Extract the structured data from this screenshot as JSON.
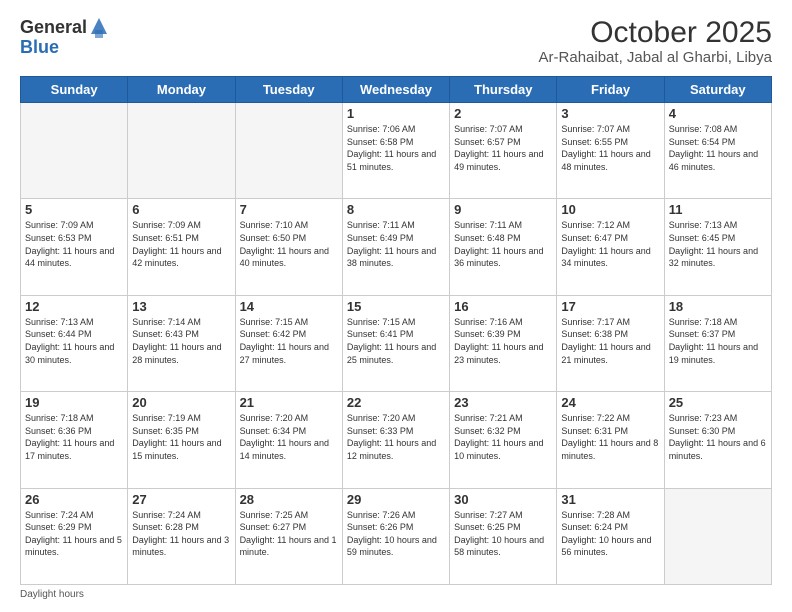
{
  "header": {
    "logo_general": "General",
    "logo_blue": "Blue",
    "title": "October 2025",
    "subtitle": "Ar-Rahaibat, Jabal al Gharbi, Libya"
  },
  "weekdays": [
    "Sunday",
    "Monday",
    "Tuesday",
    "Wednesday",
    "Thursday",
    "Friday",
    "Saturday"
  ],
  "footer": {
    "note": "Daylight hours"
  },
  "weeks": [
    [
      {
        "day": "",
        "info": ""
      },
      {
        "day": "",
        "info": ""
      },
      {
        "day": "",
        "info": ""
      },
      {
        "day": "1",
        "info": "Sunrise: 7:06 AM\nSunset: 6:58 PM\nDaylight: 11 hours\nand 51 minutes."
      },
      {
        "day": "2",
        "info": "Sunrise: 7:07 AM\nSunset: 6:57 PM\nDaylight: 11 hours\nand 49 minutes."
      },
      {
        "day": "3",
        "info": "Sunrise: 7:07 AM\nSunset: 6:55 PM\nDaylight: 11 hours\nand 48 minutes."
      },
      {
        "day": "4",
        "info": "Sunrise: 7:08 AM\nSunset: 6:54 PM\nDaylight: 11 hours\nand 46 minutes."
      }
    ],
    [
      {
        "day": "5",
        "info": "Sunrise: 7:09 AM\nSunset: 6:53 PM\nDaylight: 11 hours\nand 44 minutes."
      },
      {
        "day": "6",
        "info": "Sunrise: 7:09 AM\nSunset: 6:51 PM\nDaylight: 11 hours\nand 42 minutes."
      },
      {
        "day": "7",
        "info": "Sunrise: 7:10 AM\nSunset: 6:50 PM\nDaylight: 11 hours\nand 40 minutes."
      },
      {
        "day": "8",
        "info": "Sunrise: 7:11 AM\nSunset: 6:49 PM\nDaylight: 11 hours\nand 38 minutes."
      },
      {
        "day": "9",
        "info": "Sunrise: 7:11 AM\nSunset: 6:48 PM\nDaylight: 11 hours\nand 36 minutes."
      },
      {
        "day": "10",
        "info": "Sunrise: 7:12 AM\nSunset: 6:47 PM\nDaylight: 11 hours\nand 34 minutes."
      },
      {
        "day": "11",
        "info": "Sunrise: 7:13 AM\nSunset: 6:45 PM\nDaylight: 11 hours\nand 32 minutes."
      }
    ],
    [
      {
        "day": "12",
        "info": "Sunrise: 7:13 AM\nSunset: 6:44 PM\nDaylight: 11 hours\nand 30 minutes."
      },
      {
        "day": "13",
        "info": "Sunrise: 7:14 AM\nSunset: 6:43 PM\nDaylight: 11 hours\nand 28 minutes."
      },
      {
        "day": "14",
        "info": "Sunrise: 7:15 AM\nSunset: 6:42 PM\nDaylight: 11 hours\nand 27 minutes."
      },
      {
        "day": "15",
        "info": "Sunrise: 7:15 AM\nSunset: 6:41 PM\nDaylight: 11 hours\nand 25 minutes."
      },
      {
        "day": "16",
        "info": "Sunrise: 7:16 AM\nSunset: 6:39 PM\nDaylight: 11 hours\nand 23 minutes."
      },
      {
        "day": "17",
        "info": "Sunrise: 7:17 AM\nSunset: 6:38 PM\nDaylight: 11 hours\nand 21 minutes."
      },
      {
        "day": "18",
        "info": "Sunrise: 7:18 AM\nSunset: 6:37 PM\nDaylight: 11 hours\nand 19 minutes."
      }
    ],
    [
      {
        "day": "19",
        "info": "Sunrise: 7:18 AM\nSunset: 6:36 PM\nDaylight: 11 hours\nand 17 minutes."
      },
      {
        "day": "20",
        "info": "Sunrise: 7:19 AM\nSunset: 6:35 PM\nDaylight: 11 hours\nand 15 minutes."
      },
      {
        "day": "21",
        "info": "Sunrise: 7:20 AM\nSunset: 6:34 PM\nDaylight: 11 hours\nand 14 minutes."
      },
      {
        "day": "22",
        "info": "Sunrise: 7:20 AM\nSunset: 6:33 PM\nDaylight: 11 hours\nand 12 minutes."
      },
      {
        "day": "23",
        "info": "Sunrise: 7:21 AM\nSunset: 6:32 PM\nDaylight: 11 hours\nand 10 minutes."
      },
      {
        "day": "24",
        "info": "Sunrise: 7:22 AM\nSunset: 6:31 PM\nDaylight: 11 hours\nand 8 minutes."
      },
      {
        "day": "25",
        "info": "Sunrise: 7:23 AM\nSunset: 6:30 PM\nDaylight: 11 hours\nand 6 minutes."
      }
    ],
    [
      {
        "day": "26",
        "info": "Sunrise: 7:24 AM\nSunset: 6:29 PM\nDaylight: 11 hours\nand 5 minutes."
      },
      {
        "day": "27",
        "info": "Sunrise: 7:24 AM\nSunset: 6:28 PM\nDaylight: 11 hours\nand 3 minutes."
      },
      {
        "day": "28",
        "info": "Sunrise: 7:25 AM\nSunset: 6:27 PM\nDaylight: 11 hours\nand 1 minute."
      },
      {
        "day": "29",
        "info": "Sunrise: 7:26 AM\nSunset: 6:26 PM\nDaylight: 10 hours\nand 59 minutes."
      },
      {
        "day": "30",
        "info": "Sunrise: 7:27 AM\nSunset: 6:25 PM\nDaylight: 10 hours\nand 58 minutes."
      },
      {
        "day": "31",
        "info": "Sunrise: 7:28 AM\nSunset: 6:24 PM\nDaylight: 10 hours\nand 56 minutes."
      },
      {
        "day": "",
        "info": ""
      }
    ]
  ]
}
